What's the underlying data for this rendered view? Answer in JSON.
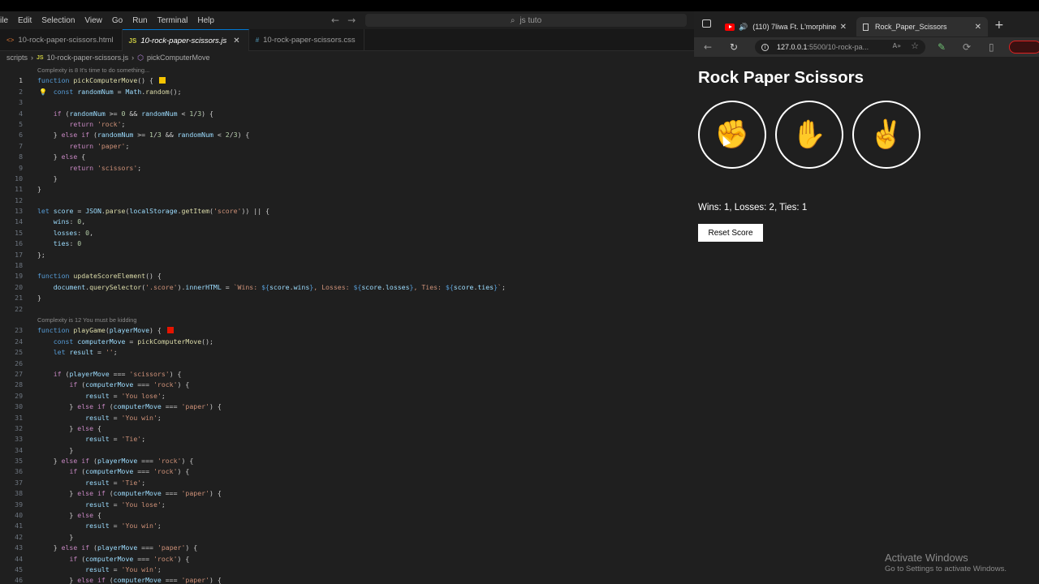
{
  "vscode": {
    "menu": [
      "ile",
      "Edit",
      "Selection",
      "View",
      "Go",
      "Run",
      "Terminal",
      "Help"
    ],
    "search": "js tuto",
    "tabs": [
      {
        "label": "10-rock-paper-scissors.html"
      },
      {
        "label": "10-rock-paper-scissors.js"
      },
      {
        "label": "10-rock-paper-scissors.css"
      }
    ],
    "breadcrumb": [
      "scripts",
      "10-rock-paper-scissors.js",
      "pickComputerMove"
    ],
    "lens": [
      "Complexity is 8 It's time to do something...",
      "Complexity is 12 You must be kidding"
    ]
  },
  "browser": {
    "tabs": [
      {
        "title": "(110) 7liwa Ft. L'morphine"
      },
      {
        "title": "Rock_Paper_Scissors"
      }
    ],
    "url": "127.0.0.1",
    "url_rest": ":5500/10-rock-pa...",
    "colors": {
      "accent": "#ffffff",
      "bg": "#1f1f1f"
    }
  },
  "page": {
    "title": "Rock Paper Scissors",
    "moves": [
      {
        "emoji": "✊",
        "icon": "rock-emoji-icon"
      },
      {
        "emoji": "✋",
        "icon": "paper-emoji-icon"
      },
      {
        "emoji": "✌️",
        "icon": "scissors-emoji-icon"
      }
    ],
    "score_text": "Wins: 1, Losses: 2, Ties: 1",
    "reset_label": "Reset Score"
  },
  "watermark": {
    "line1": "Activate Windows",
    "line2": "Go to Settings to activate Windows."
  }
}
